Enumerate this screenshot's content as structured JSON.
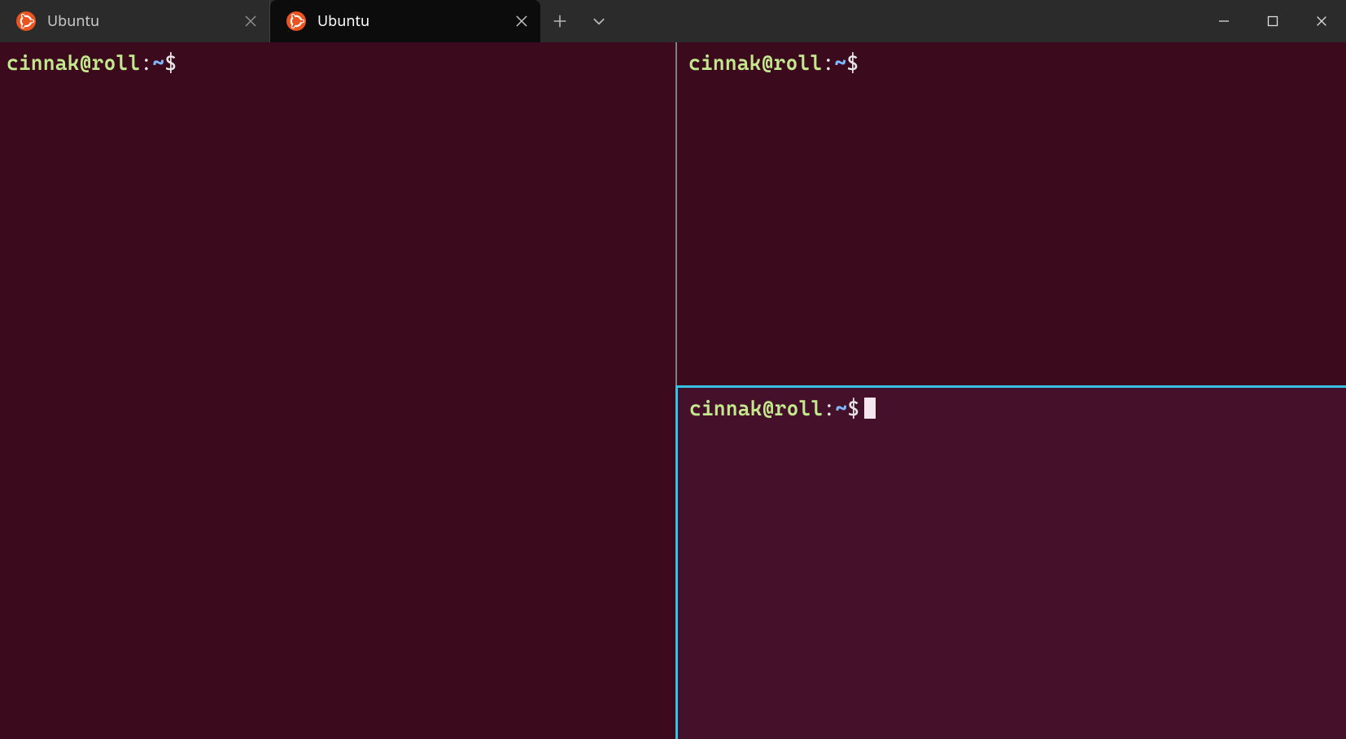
{
  "tabs": [
    {
      "label": "Ubuntu",
      "active": false,
      "icon": "ubuntu-logo"
    },
    {
      "label": "Ubuntu",
      "active": true,
      "icon": "ubuntu-logo"
    }
  ],
  "panes": {
    "left": {
      "prompt": {
        "userhost": "cinnak@roll",
        "cwd": "~",
        "symbol": "$"
      },
      "has_cursor": false
    },
    "right_top": {
      "prompt": {
        "userhost": "cinnak@roll",
        "cwd": "~",
        "symbol": "$"
      },
      "has_cursor": false
    },
    "right_bottom": {
      "prompt": {
        "userhost": "cinnak@roll",
        "cwd": "~",
        "symbol": "$"
      },
      "has_cursor": true,
      "focused": true
    }
  },
  "colors": {
    "accent": "#35c2e5",
    "terminal_bg": "#3b0a1d",
    "terminal_bg_focused": "#44102a",
    "prompt_user": "#c3e88d",
    "prompt_path": "#7fb8ff"
  }
}
